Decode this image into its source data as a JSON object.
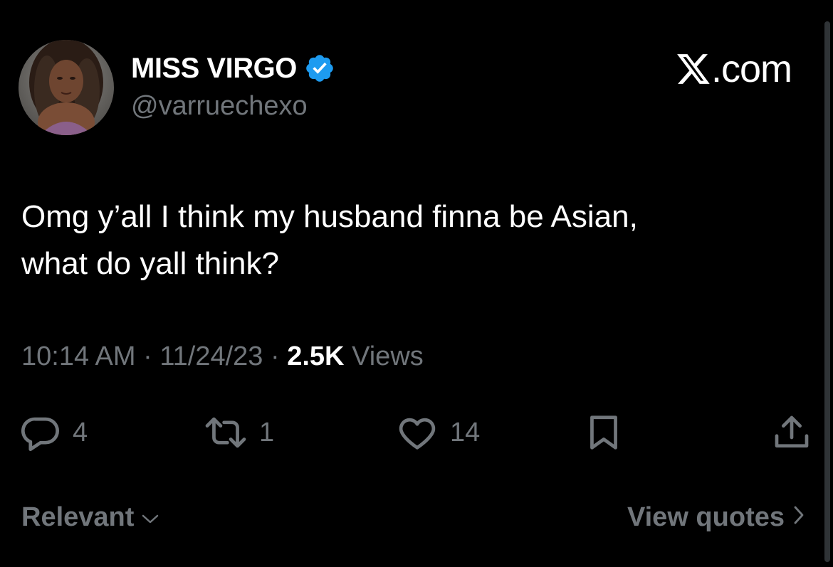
{
  "author": {
    "display_name": "MISS VIRGO",
    "handle": "@varruechexo",
    "verified": true,
    "avatar_icon": "profile-photo"
  },
  "brand": {
    "label": ".com",
    "icon": "x-logo-icon"
  },
  "tweet": {
    "lines": [
      "Omg y’all I think my husband finna be Asian,",
      "what do yall think?"
    ]
  },
  "meta": {
    "time": "10:14 AM",
    "separator": "·",
    "date": "11/24/23",
    "views_count": "2.5K",
    "views_label": "Views"
  },
  "actions": {
    "replies": "4",
    "reposts": "1",
    "likes": "14"
  },
  "footer": {
    "sort_label": "Relevant",
    "view_quotes_label": "View quotes"
  },
  "colors": {
    "background": "#000000",
    "text_primary": "#ffffff",
    "text_secondary": "#71767b",
    "verified_blue": "#1d9bf0"
  }
}
